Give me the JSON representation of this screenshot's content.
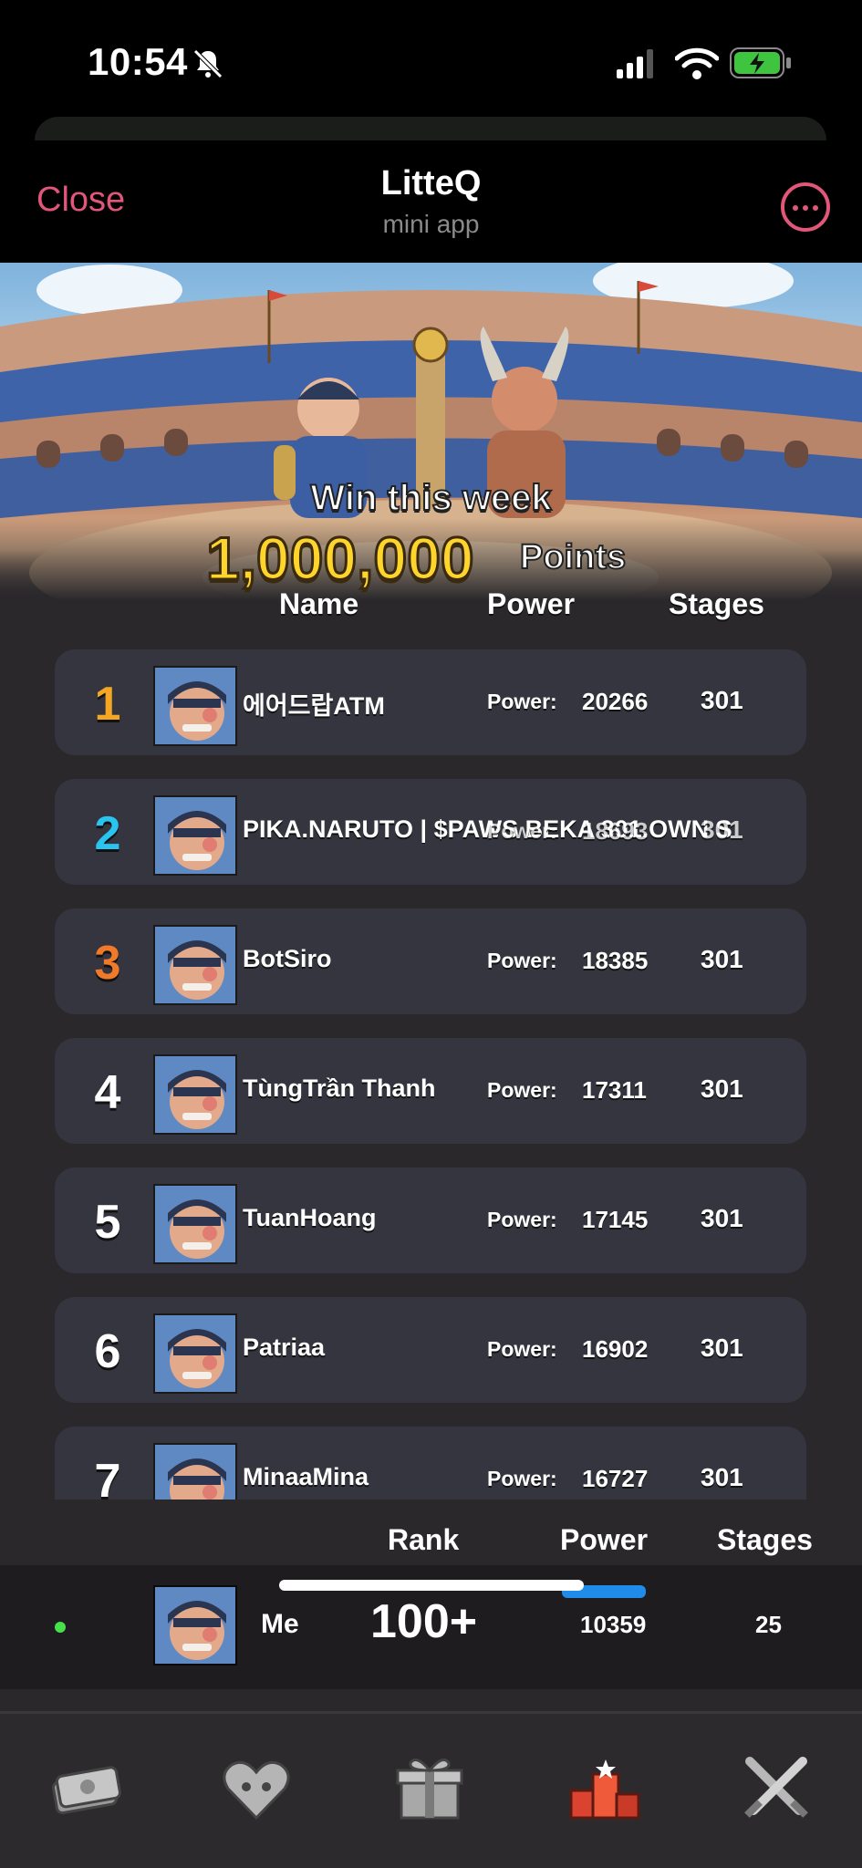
{
  "status_bar": {
    "time": "10:54"
  },
  "header": {
    "close_label": "Close",
    "title": "LitteQ",
    "subtitle": "mini app"
  },
  "banner": {
    "headline": "Win this week",
    "prize_amount": "1,000,000",
    "prize_unit": "Points"
  },
  "columns": {
    "name": "Name",
    "power": "Power",
    "stages": "Stages"
  },
  "leaderboard": [
    {
      "rank": "1",
      "rank_color": "#f5a623",
      "name": "에어드랍ATM",
      "power_label": "Power:",
      "power": "20266",
      "stages": "301"
    },
    {
      "rank": "2",
      "rank_color": "#29c4f0",
      "name": "PIKA.NARUTO |  $PAWS BEKA 301.OWN S",
      "power_label": "Power:",
      "power": "18693",
      "stages": "301"
    },
    {
      "rank": "3",
      "rank_color": "#f07a2a",
      "name": "BotSiro",
      "power_label": "Power:",
      "power": "18385",
      "stages": "301"
    },
    {
      "rank": "4",
      "rank_color": "#ffffff",
      "name": "TùngTrần Thanh",
      "power_label": "Power:",
      "power": "17311",
      "stages": "301"
    },
    {
      "rank": "5",
      "rank_color": "#ffffff",
      "name": "TuanHoang",
      "power_label": "Power:",
      "power": "17145",
      "stages": "301"
    },
    {
      "rank": "6",
      "rank_color": "#ffffff",
      "name": "Patriaa",
      "power_label": "Power:",
      "power": "16902",
      "stages": "301"
    },
    {
      "rank": "7",
      "rank_color": "#ffffff",
      "name": "MinaaMina",
      "power_label": "Power:",
      "power": "16727",
      "stages": "301"
    }
  ],
  "me": {
    "headers": {
      "rank": "Rank",
      "power": "Power",
      "stages": "Stages"
    },
    "name": "Me",
    "rank": "100+",
    "power": "10359",
    "stages": "25"
  },
  "nav": {
    "items": [
      {
        "icon": "cash-icon"
      },
      {
        "icon": "heart-pet-icon"
      },
      {
        "icon": "gift-icon"
      },
      {
        "icon": "ranking-podium-icon",
        "active": true
      },
      {
        "icon": "battle-swords-icon"
      }
    ]
  },
  "colors": {
    "accent": "#e2567a",
    "gold": "#ffd52b",
    "active_tab": "#1e8ce8",
    "online": "#45e04a"
  }
}
